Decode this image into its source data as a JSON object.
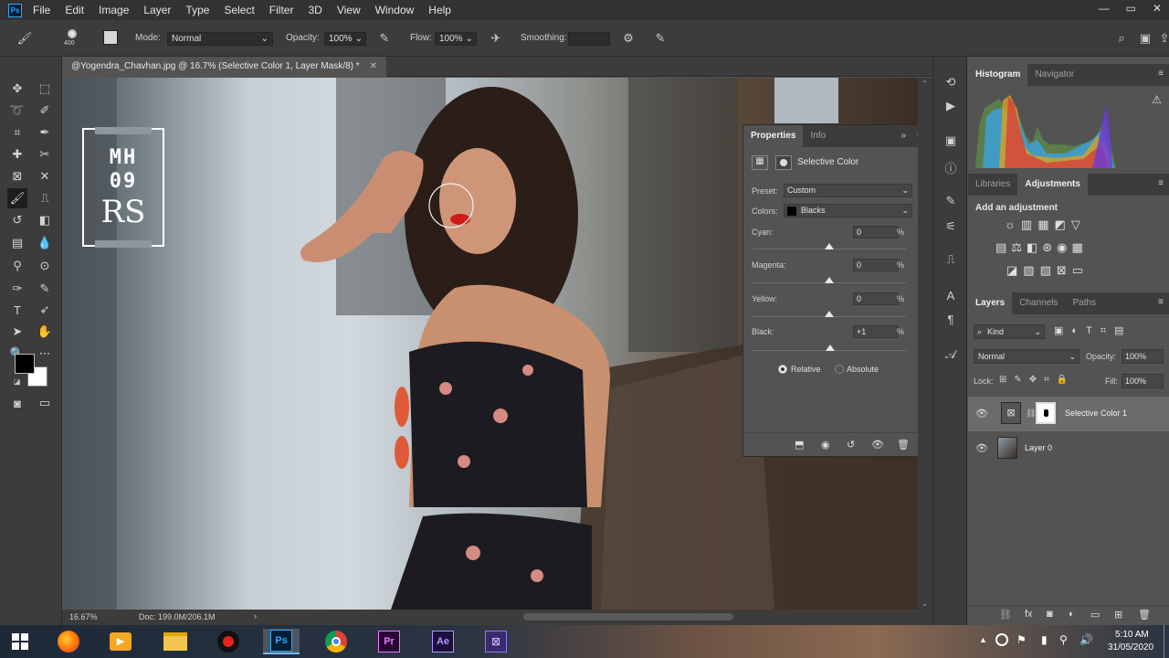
{
  "menu": {
    "logo": "Ps",
    "items": [
      "File",
      "Edit",
      "Image",
      "Layer",
      "Type",
      "Select",
      "Filter",
      "3D",
      "View",
      "Window",
      "Help"
    ],
    "window_controls": [
      "—",
      "▭",
      "✕"
    ]
  },
  "options": {
    "brush_size": "400",
    "mode_label": "Mode:",
    "mode_value": "Normal",
    "opacity_label": "Opacity:",
    "opacity_value": "100%",
    "flow_label": "Flow:",
    "flow_value": "100%",
    "smoothing_label": "Smoothing:",
    "smoothing_value": ""
  },
  "document": {
    "tab_title": "@Yogendra_Chavhan.jpg @ 16.7% (Selective Color 1, Layer Mask/8) *",
    "close": "✕",
    "watermark_line1": "MH",
    "watermark_line2": "09",
    "watermark_line3": "RS"
  },
  "status": {
    "zoom": "16.67%",
    "doc_size": "Doc: 199.0M/206.1M",
    "arrow": "›"
  },
  "properties_panel": {
    "tabs": [
      "Properties",
      "Info"
    ],
    "title": "Selective Color",
    "preset_label": "Preset:",
    "preset_value": "Custom",
    "colors_label": "Colors:",
    "colors_value": "Blacks",
    "sliders": [
      {
        "label": "Cyan:",
        "value": "0",
        "unit": "%",
        "position": 0.5
      },
      {
        "label": "Magenta:",
        "value": "0",
        "unit": "%",
        "position": 0.5
      },
      {
        "label": "Yellow:",
        "value": "0",
        "unit": "%",
        "position": 0.5
      },
      {
        "label": "Black:",
        "value": "+1",
        "unit": "%",
        "position": 0.505
      }
    ],
    "method_relative": "Relative",
    "method_absolute": "Absolute",
    "method_selected": "Relative"
  },
  "histogram_panel": {
    "tabs": [
      "Histogram",
      "Navigator"
    ],
    "warning": "⚠"
  },
  "adjustments_panel": {
    "tabs": [
      "Libraries",
      "Adjustments"
    ],
    "heading": "Add an adjustment"
  },
  "layers_panel": {
    "tabs": [
      "Layers",
      "Channels",
      "Paths"
    ],
    "filter_kind": "Kind",
    "blend_mode": "Normal",
    "opacity_label": "Opacity:",
    "opacity_value": "100%",
    "lock_label": "Lock:",
    "fill_label": "Fill:",
    "fill_value": "100%",
    "layers": [
      {
        "name": "Selective Color 1",
        "type": "adjustment",
        "visible": true,
        "selected": true
      },
      {
        "name": "Layer 0",
        "type": "image",
        "visible": true,
        "selected": false
      }
    ]
  },
  "taskbar": {
    "apps": [
      "windows-start",
      "firefox",
      "media-player",
      "file-explorer",
      "recorder",
      "photoshop",
      "chrome",
      "premiere",
      "after-effects",
      "other-app"
    ],
    "active_app": "photoshop",
    "app_labels": {
      "photoshop": "Ps",
      "premiere": "Pr",
      "after_effects": "Ae"
    },
    "time": "5:10 AM",
    "date": "31/05/2020",
    "tray_arrow": "▲"
  },
  "colors": {
    "menubar_bg": "#323232",
    "panel_bg": "#535353",
    "dark_bg": "#3c3c3c",
    "foreground_swatch": "#000000",
    "background_swatch": "#ffffff"
  }
}
